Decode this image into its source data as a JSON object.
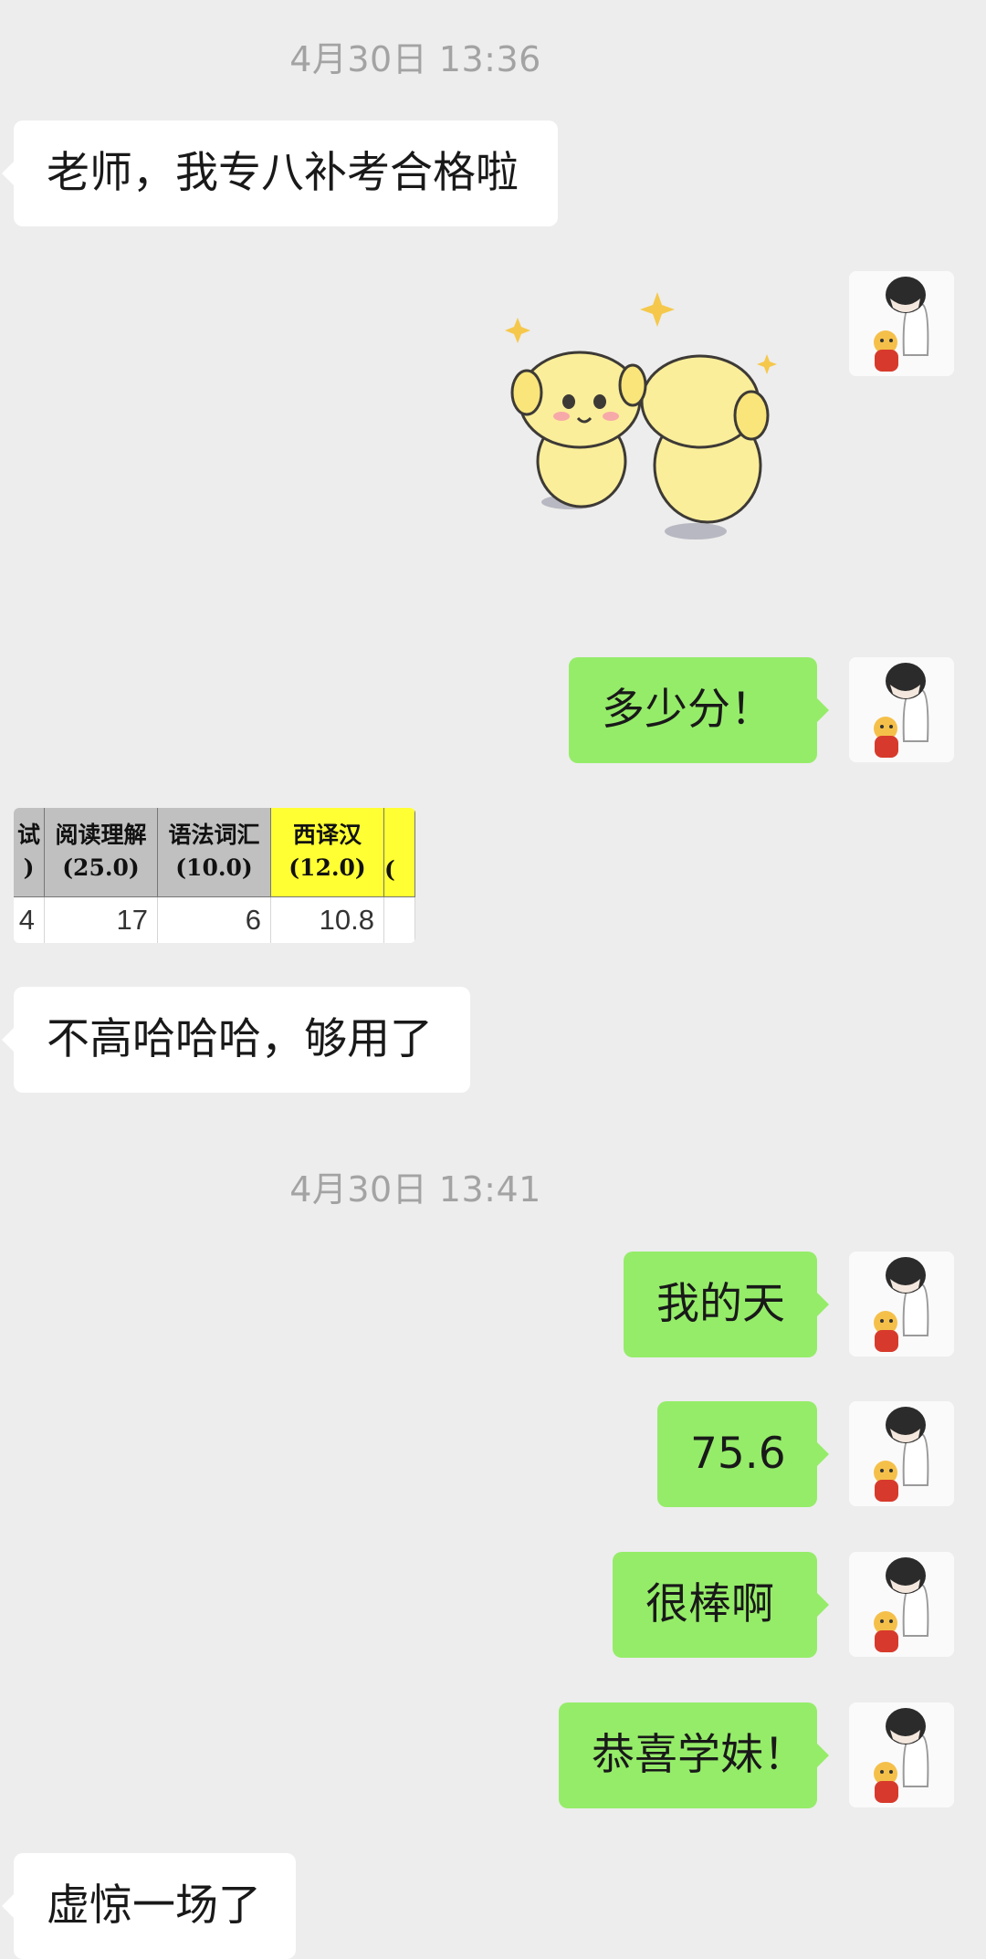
{
  "timestamps": [
    "4月30日 13:36",
    "4月30日 13:41"
  ],
  "messages": [
    {
      "side": "in",
      "text": "老师，我专八补考合格啦"
    },
    {
      "side": "out",
      "type": "sticker",
      "icon": "hugging-dogs-sticker"
    },
    {
      "side": "out",
      "text": "多少分！"
    },
    {
      "side": "in",
      "type": "image",
      "icon": "score-spreadsheet-image"
    },
    {
      "side": "in",
      "text": "不高哈哈哈，够用了"
    },
    {
      "side": "out",
      "text": "我的天"
    },
    {
      "side": "out",
      "text": "75.6"
    },
    {
      "side": "out",
      "text": "很棒啊"
    },
    {
      "side": "out",
      "text": "恭喜学妹！"
    },
    {
      "side": "in",
      "text": "虚惊一场了"
    }
  ],
  "score_table": {
    "headers": [
      {
        "name": "试",
        "score": ")"
      },
      {
        "name": "阅读理解",
        "score": "(25.0)"
      },
      {
        "name": "语法词汇",
        "score": "(10.0)"
      },
      {
        "name": "西译汉",
        "score": "(12.0)"
      },
      {
        "name": "",
        "score": "("
      }
    ],
    "values": [
      "4",
      "17",
      "6",
      "10.8",
      ""
    ],
    "highlight_color": "#ffff33",
    "header_color": "#c0c0c0"
  },
  "colors": {
    "background": "#ededed",
    "incoming": "#ffffff",
    "outgoing": "#95ec69"
  }
}
